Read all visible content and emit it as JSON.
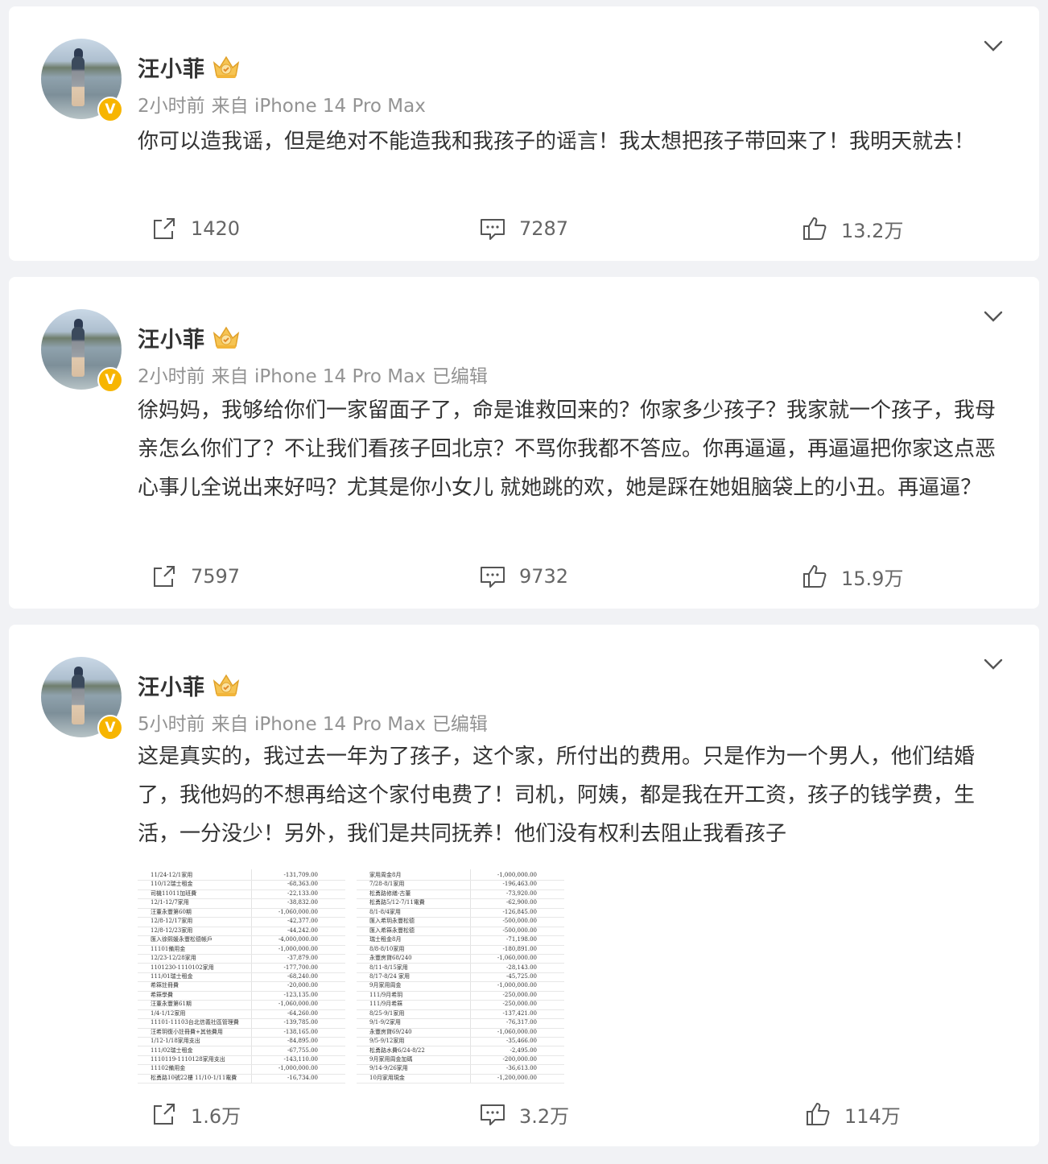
{
  "posts": [
    {
      "author": "汪小菲",
      "avatar_icon": "avatar-image",
      "verified_badge": "V",
      "crown_icon": "crown-icon",
      "time": "2小时前",
      "source": "来自 iPhone 14 Pro Max",
      "edited": "",
      "text": "你可以造我谣，但是绝对不能造我和我孩子的谣言！我太想把孩子带回来了！我明天就去！",
      "reposts": "1420",
      "comments": "7287",
      "likes": "13.2万"
    },
    {
      "author": "汪小菲",
      "avatar_icon": "avatar-image",
      "verified_badge": "V",
      "crown_icon": "crown-icon",
      "time": "2小时前",
      "source": "来自 iPhone 14 Pro Max",
      "edited": "已编辑",
      "text": "徐妈妈，我够给你们一家留面子了，命是谁救回来的？你家多少孩子？我家就一个孩子，我母亲怎么你们了？不让我们看孩子回北京？不骂你我都不答应。你再逼逼，再逼逼把你家这点恶心事儿全说出来好吗？尤其是你小女儿 就她跳的欢，她是踩在她姐脑袋上的小丑。再逼逼？",
      "reposts": "7597",
      "comments": "9732",
      "likes": "15.9万"
    },
    {
      "author": "汪小菲",
      "avatar_icon": "avatar-image",
      "verified_badge": "V",
      "crown_icon": "crown-icon",
      "time": "5小时前",
      "source": "来自 iPhone 14 Pro Max",
      "edited": "已编辑",
      "text": "这是真实的，我过去一年为了孩子，这个家，所付出的费用。只是作为一个男人，他们结婚了，我他妈的不想再给这个家付电费了！司机，阿姨，都是我在开工资，孩子的钱学费，生活，一分没少！另外，我们是共同抚养！他们没有权利去阻止我看孩子",
      "reposts": "1.6万",
      "comments": "3.2万",
      "likes": "114万",
      "images": [
        {
          "rows": [
            [
              "11/24-12/1家用",
              "-131,709.00"
            ],
            [
              "110/12瑞士租金",
              "-68,363.00"
            ],
            [
              "司機11011加班費",
              "-22,133.00"
            ],
            [
              "12/1-12/7家用",
              "-38,832.00"
            ],
            [
              "汪董永豐第60期",
              "-1,060,000.00"
            ],
            [
              "12/8-12/17家用",
              "-42,377.00"
            ],
            [
              "12/8-12/23家用",
              "-44,242.00"
            ],
            [
              "匯入徐熙媛永豐松德帳戶",
              "-4,000,000.00"
            ],
            [
              "11101備用金",
              "-1,000,000.00"
            ],
            [
              "12/23-12/28家用",
              "-37,879.00"
            ],
            [
              "1101230-1110102家用",
              "-177,700.00"
            ],
            [
              "111/01瑞士租金",
              "-68,240.00"
            ],
            [
              "希箖註冊費",
              "-20,000.00"
            ],
            [
              "希箖學費",
              "-123,135.00"
            ],
            [
              "汪董永豐第61期",
              "-1,060,000.00"
            ],
            [
              "1/4-1/12家用",
              "-64,260.00"
            ],
            [
              "11101-11103台北信義社區管理費",
              "-139,785.00"
            ],
            [
              "汪希玥復小註冊費+其他費用",
              "-138,165.00"
            ],
            [
              "1/12-1/18家用支出",
              "-84,895.00"
            ],
            [
              "111/02瑞士租金",
              "-67,755.00"
            ],
            [
              "1110119-1110128家用支出",
              "-143,110.00"
            ],
            [
              "11102備用金",
              "-1,000,000.00"
            ],
            [
              "松勇路10號22樓 11/10-1/11電費",
              "-16,734.00"
            ]
          ]
        },
        {
          "rows": [
            [
              "家用周金8月",
              "-1,000,000.00"
            ],
            [
              "7/28-8/1家用",
              "-196,463.00"
            ],
            [
              "松勇路修繕-古董",
              "-73,920.00"
            ],
            [
              "松勇路5/12-7/11電費",
              "-62,900.00"
            ],
            [
              "8/1-8/4家用",
              "-126,845.00"
            ],
            [
              "匯入希玥永豐松德",
              "-500,000.00"
            ],
            [
              "匯入希箖永豐松德",
              "-500,000.00"
            ],
            [
              "瑞士租金8月",
              "-71,198.00"
            ],
            [
              "8/8-8/10家用",
              "-180,891.00"
            ],
            [
              "永豐房貸68/240",
              "-1,060,000.00"
            ],
            [
              "8/11-8/15家用",
              "-28,143.00"
            ],
            [
              "8/17-8/24 家用",
              "-45,725.00"
            ],
            [
              "9月家用周金",
              "-1,000,000.00"
            ],
            [
              "111/9月希玥",
              "-250,000.00"
            ],
            [
              "111/9月希箖",
              "-250,000.00"
            ],
            [
              "8/25-9/1家用",
              "-137,421.00"
            ],
            [
              "9/1-9/2家用",
              "-76,317.00"
            ],
            [
              "永豐房貸69/240",
              "-1,060,000.00"
            ],
            [
              "9/5-9/12家用",
              "-35,466.00"
            ],
            [
              "松勇路水費6/24-8/22",
              "-2,495.00"
            ],
            [
              "9月家用周金加碼",
              "-200,000.00"
            ],
            [
              "9/14-9/26家用",
              "-36,613.00"
            ],
            [
              "10月家用現金",
              "-1,200,000.00"
            ]
          ]
        }
      ]
    }
  ],
  "colors": {
    "page_bg": "#f1f2f5",
    "card_bg": "#ffffff",
    "verified": "#f7b500",
    "meta": "#939393",
    "text": "#333333"
  }
}
